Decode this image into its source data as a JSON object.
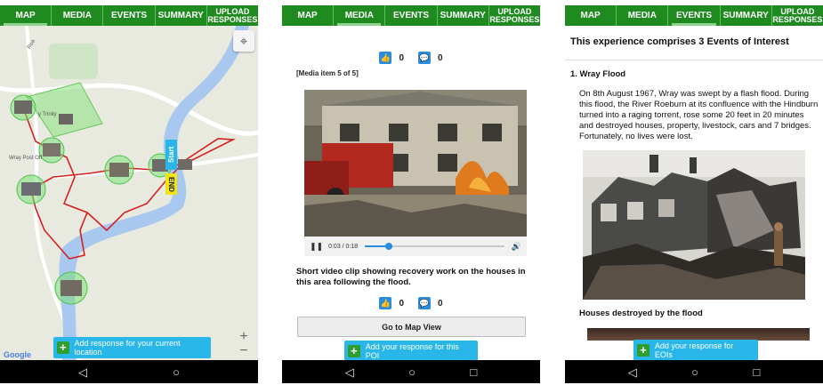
{
  "tabs": {
    "map": "MAP",
    "media": "MEDIA",
    "events": "EVENTS",
    "summary": "SUMMARY",
    "upload_line1": "UPLOAD",
    "upload_line2": "RESPONSES"
  },
  "map_screen": {
    "active_tab": "MAP",
    "start_label": "Start",
    "end_label": "END",
    "place_label": "Wray Post Off",
    "place_label2": "y Trinity",
    "road_label": "Roa",
    "zoom_in": "+",
    "zoom_out": "−",
    "attribution": "Google",
    "add_response_label": "Add response for your current location"
  },
  "media_screen": {
    "active_tab": "MEDIA",
    "likes_top": "0",
    "comments_top": "0",
    "media_index": "[Media item 5 of 5]",
    "video_time": "0:03 / 0:18",
    "video_progress": 0.17,
    "caption": "Short video clip showing recovery work on the houses in this area following the flood.",
    "likes_bottom": "0",
    "comments_bottom": "0",
    "goto_map_label": "Go to Map View",
    "add_response_label": "Add your response for this POI"
  },
  "events_screen": {
    "active_tab": "EVENTS",
    "heading": "This experience comprises 3 Events of Interest",
    "event_title": "1. Wray Flood",
    "event_body": "On 8th August 1967, Wray was swept by a flash flood. During this flood, the River Roeburn at its confluence with the Hindburn turned into a raging torrent, rose some 20 feet in 20 minutes and destroyed houses, property, livestock, cars and 7 bridges. Fortunately, no lives were lost.",
    "photo_caption": "Houses destroyed by the flood",
    "add_response_label": "Add your response for EOIs"
  },
  "navbar": {
    "back": "◁",
    "home": "○",
    "recents": "□"
  },
  "colors": {
    "tab_green": "#1f8a1f",
    "button_blue": "#29b6e8",
    "plus_green": "#2e9e2e",
    "route_red": "#d42020",
    "river_blue": "#a9c8f0"
  }
}
